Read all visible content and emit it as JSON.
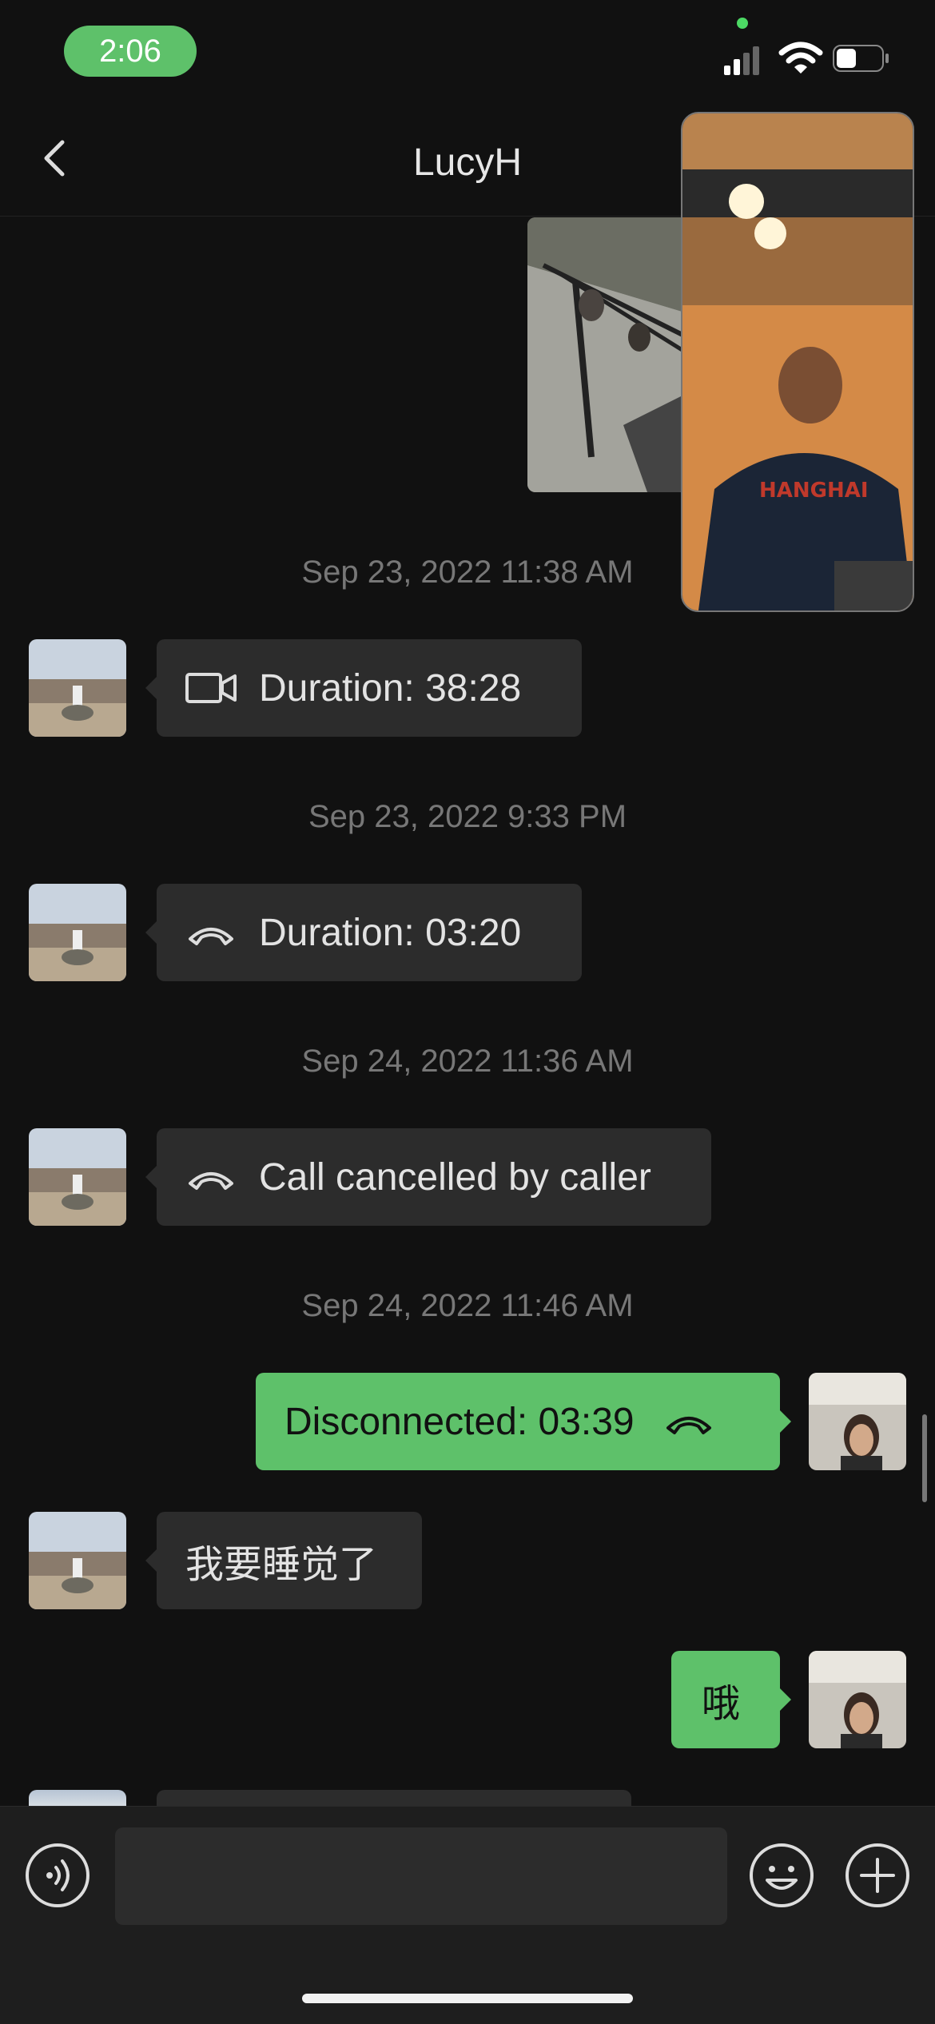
{
  "status_bar": {
    "time": "2:06"
  },
  "nav": {
    "title": "LucyH"
  },
  "messages": [
    {
      "timestamp": "Sep 23, 2022 11:38 AM",
      "text": "Duration: 38:28",
      "icon": "video-call-icon"
    },
    {
      "timestamp": "Sep 23, 2022 9:33 PM",
      "text": "Duration: 03:20",
      "icon": "phone-hangup-icon"
    },
    {
      "timestamp": "Sep 24, 2022 11:36 AM",
      "text": "Call cancelled by caller",
      "icon": "phone-hangup-icon"
    },
    {
      "timestamp": "Sep 24, 2022 11:46 AM",
      "text": "Disconnected: 03:39",
      "icon": "phone-hangup-icon"
    },
    {
      "text": "我要睡觉了"
    },
    {
      "text": "哦"
    }
  ],
  "colors": {
    "accent_green": "#5ec16a",
    "background": "#111111",
    "incoming_bubble": "#2c2c2c"
  }
}
